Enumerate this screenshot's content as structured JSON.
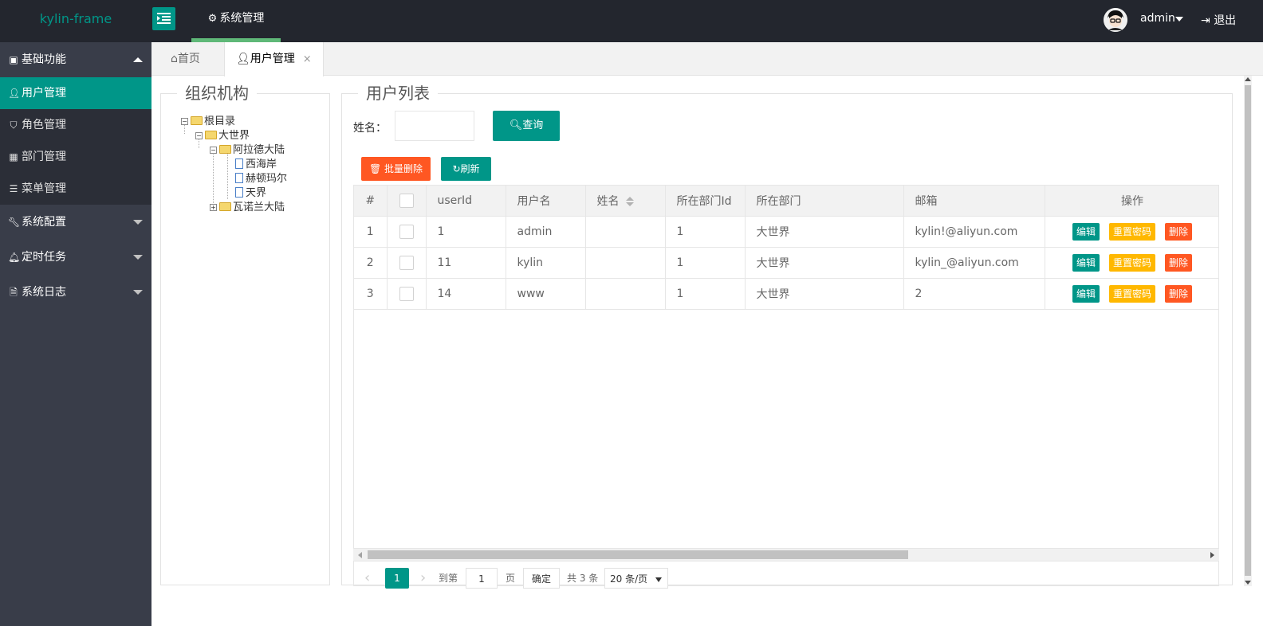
{
  "header": {
    "logo": "kylin-frame",
    "nav_item": "系统管理",
    "username": "admin",
    "logout": "退出"
  },
  "sidebar": {
    "groups": [
      {
        "label": "基础功能",
        "icon": "box-icon",
        "expanded": true,
        "items": [
          {
            "label": "用户管理",
            "icon": "user-icon",
            "active": true
          },
          {
            "label": "角色管理",
            "icon": "shield-icon"
          },
          {
            "label": "部门管理",
            "icon": "building-icon"
          },
          {
            "label": "菜单管理",
            "icon": "menu-icon"
          }
        ]
      },
      {
        "label": "系统配置",
        "icon": "wrench-icon",
        "expanded": false
      },
      {
        "label": "定时任务",
        "icon": "bell-icon",
        "expanded": false
      },
      {
        "label": "系统日志",
        "icon": "file-icon",
        "expanded": false
      }
    ]
  },
  "tabs": [
    {
      "label": "首页",
      "icon": "home-icon"
    },
    {
      "label": "用户管理",
      "icon": "user-icon",
      "active": true,
      "close": "×"
    }
  ],
  "org_panel": {
    "title": "组织机构",
    "tree": {
      "root": "根目录",
      "world": "大世界",
      "continent1": "阿拉德大陆",
      "leaf1": "西海岸",
      "leaf2": "赫顿玛尔",
      "leaf3": "天界",
      "continent2": "瓦诺兰大陆"
    }
  },
  "user_panel": {
    "title": "用户列表",
    "search_label": "姓名：",
    "search_value": "",
    "query_button": "查询",
    "batch_delete_button": "批量删除",
    "refresh_button": "刷新"
  },
  "table": {
    "columns": [
      "#",
      "",
      "userId",
      "用户名",
      "姓名",
      "所在部门Id",
      "所在部门",
      "邮箱",
      "操作"
    ],
    "rows": [
      {
        "idx": "1",
        "userId": "1",
        "username": "admin",
        "name": "",
        "deptId": "1",
        "dept": "大世界",
        "email": "kylin!@aliyun.com"
      },
      {
        "idx": "2",
        "userId": "11",
        "username": "kylin",
        "name": "",
        "deptId": "1",
        "dept": "大世界",
        "email": "kylin_@aliyun.com"
      },
      {
        "idx": "3",
        "userId": "14",
        "username": "www",
        "name": "",
        "deptId": "1",
        "dept": "大世界",
        "email": "2"
      }
    ],
    "actions": {
      "edit": "编辑",
      "reset": "重置密码",
      "delete": "删除"
    }
  },
  "pager": {
    "prev": "‹",
    "current": "1",
    "next": "›",
    "goto_label": "到第",
    "goto_value": "1",
    "page_label": "页",
    "confirm": "确定",
    "total": "共 3 条",
    "page_size": "20 条/页"
  },
  "colors": {
    "accent": "#009688",
    "warning": "#FFB800",
    "danger": "#FF5722",
    "header_bg": "#23262E",
    "sidebar_bg": "#393D49"
  }
}
